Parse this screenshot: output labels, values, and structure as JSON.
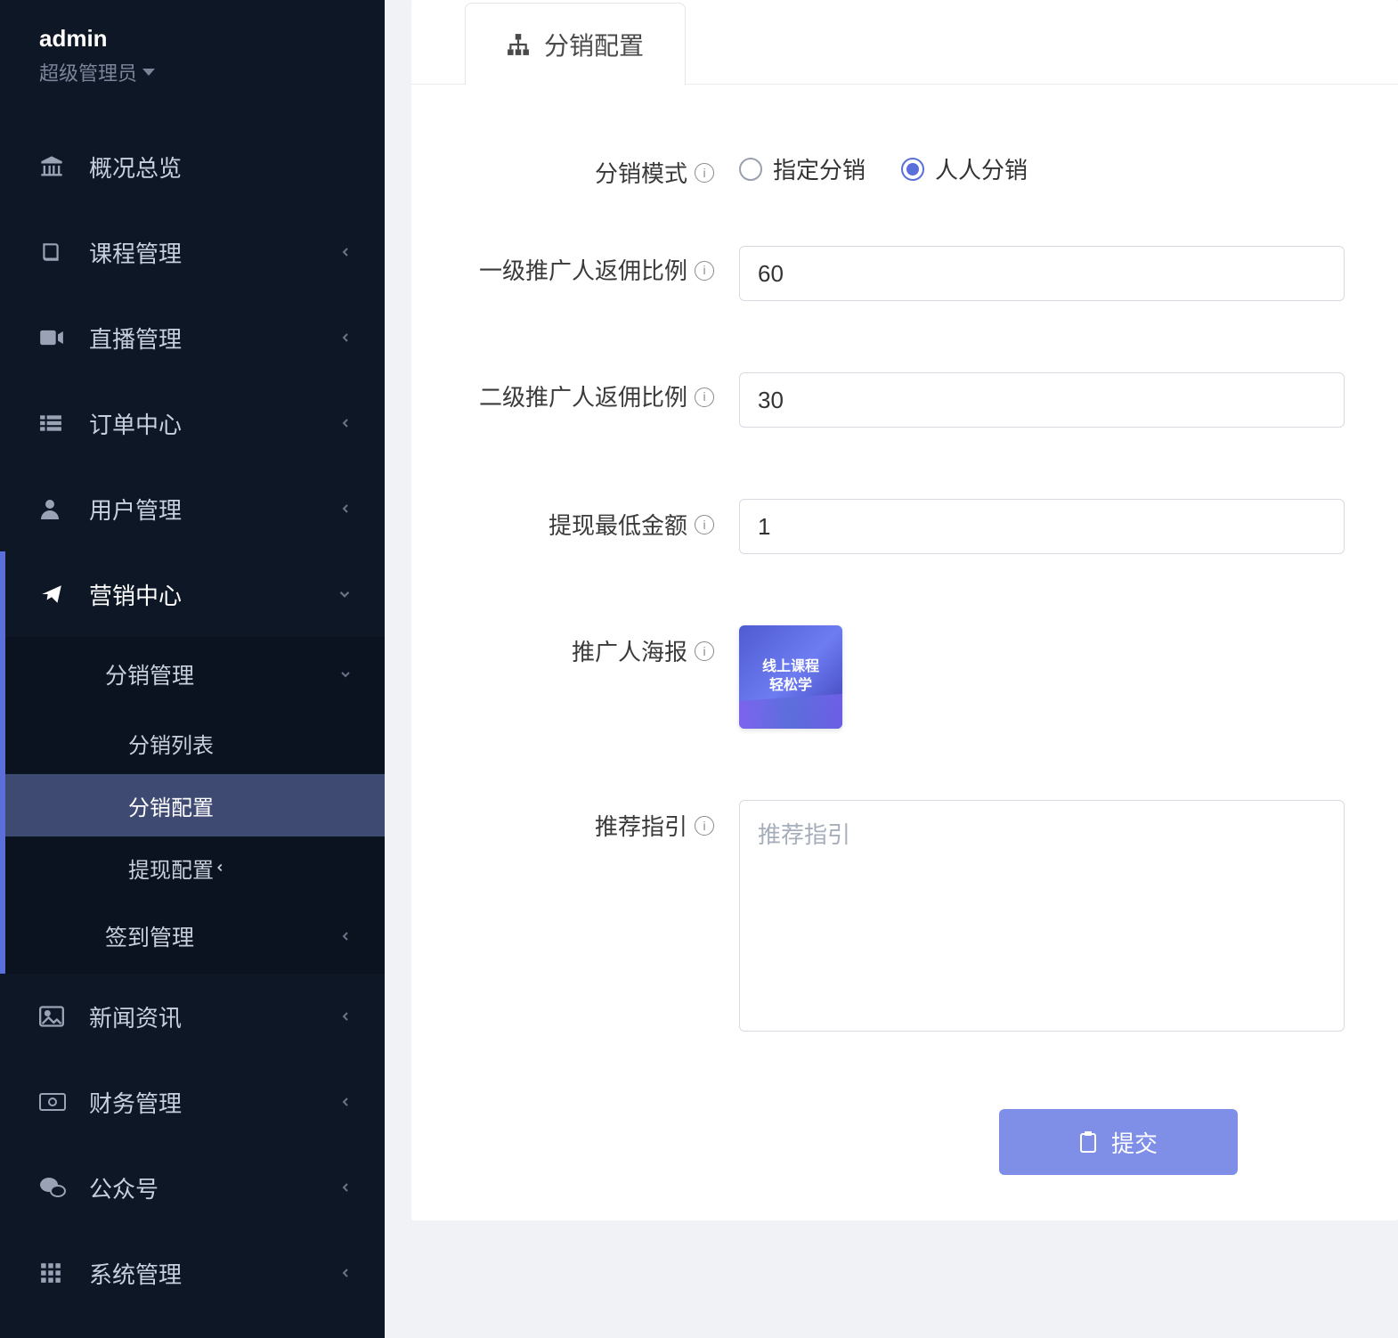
{
  "sidebar": {
    "user": {
      "name": "admin",
      "role": "超级管理员"
    },
    "items": [
      {
        "key": "overview",
        "label": "概况总览",
        "expandable": false
      },
      {
        "key": "course",
        "label": "课程管理",
        "expandable": true
      },
      {
        "key": "live",
        "label": "直播管理",
        "expandable": true
      },
      {
        "key": "orders",
        "label": "订单中心",
        "expandable": true
      },
      {
        "key": "users",
        "label": "用户管理",
        "expandable": true
      },
      {
        "key": "marketing",
        "label": "营销中心",
        "expandable": true,
        "expanded": true,
        "children": [
          {
            "key": "distribution",
            "label": "分销管理",
            "expandable": true,
            "expanded": true,
            "children": [
              {
                "key": "dist-list",
                "label": "分销列表"
              },
              {
                "key": "dist-config",
                "label": "分销配置",
                "active": true
              },
              {
                "key": "withdraw-cfg",
                "label": "提现配置",
                "expandable": true
              }
            ]
          },
          {
            "key": "sign-in",
            "label": "签到管理",
            "expandable": true
          }
        ]
      },
      {
        "key": "news",
        "label": "新闻资讯",
        "expandable": true
      },
      {
        "key": "finance",
        "label": "财务管理",
        "expandable": true
      },
      {
        "key": "wechat",
        "label": "公众号",
        "expandable": true
      },
      {
        "key": "system",
        "label": "系统管理",
        "expandable": true
      }
    ]
  },
  "tabs": {
    "active_label": "分销配置"
  },
  "form": {
    "mode": {
      "label": "分销模式",
      "options": [
        {
          "key": "appointed",
          "label": "指定分销"
        },
        {
          "key": "everyone",
          "label": "人人分销"
        }
      ],
      "selected": "everyone"
    },
    "level1_rate": {
      "label": "一级推广人返佣比例",
      "value": "60"
    },
    "level2_rate": {
      "label": "二级推广人返佣比例",
      "value": "30"
    },
    "min_withdraw": {
      "label": "提现最低金额",
      "value": "1"
    },
    "poster": {
      "label": "推广人海报",
      "thumb_text_top": "线上课程",
      "thumb_text_bottom": "轻松学"
    },
    "guide": {
      "label": "推荐指引",
      "placeholder": "推荐指引",
      "value": ""
    },
    "submit": {
      "label": "提交"
    }
  },
  "colors": {
    "accent": "#5b6fdb",
    "sidebar_bg": "#0e1726"
  }
}
